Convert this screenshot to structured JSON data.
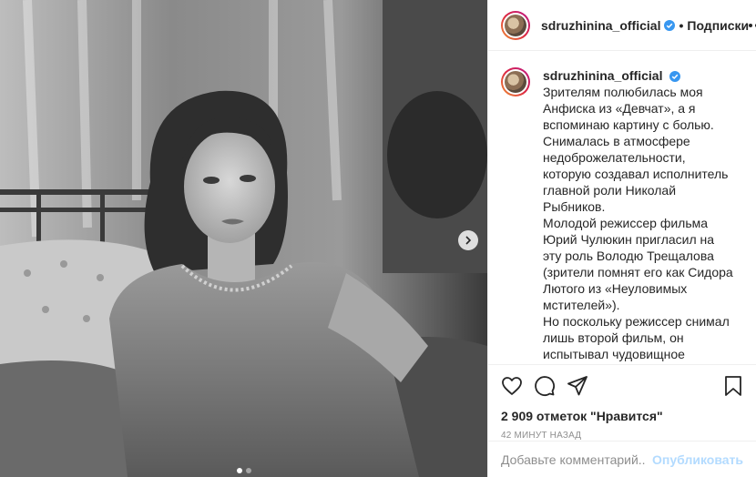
{
  "post": {
    "username": "sdruzhinina_official",
    "follow_label": "Подписки",
    "separator": "•",
    "verified_icon": "verified-badge-icon",
    "verified_color": "#3897f0",
    "caption_paragraphs": [
      "Зрителям полюбилась моя Анфиска из «Девчат», а я вспоминаю картину с болью.",
      "Снималась в атмосфере недоброжелательности, которую создавал исполнитель главной роли Николай Рыбников.",
      "Молодой режиссер фильма Юрий Чулюкин пригласил на эту роль Володю Трещалова (зрители помнят его как Сидора Лютого из «Неуловимых мстителей»).",
      "Но поскольку режиссер снимал лишь второй фильм, он испытывал чудовищное давление начальства. Мы поддерживали его, шутили: «Юра успокойся... Николая Рыбникова и Инну Макарову тебе спустили с высоты... » Они только"
    ],
    "likes_text": "2 909 отметок \"Нравится\"",
    "timestamp": "42 МИНУТ НАЗАД",
    "comment_placeholder": "Добавьте комментарий...",
    "publish_label": "Опубликовать",
    "carousel": {
      "total": 2,
      "active_index": 0
    }
  },
  "icons": {
    "like": "heart-icon",
    "comment": "comment-icon",
    "share": "share-icon",
    "save": "bookmark-icon",
    "more": "more-options-icon",
    "next": "chevron-right-icon"
  },
  "colors": {
    "text": "#262626",
    "muted": "#8e8e8e",
    "border": "#efefef",
    "publish_disabled": "#b3dbff"
  }
}
